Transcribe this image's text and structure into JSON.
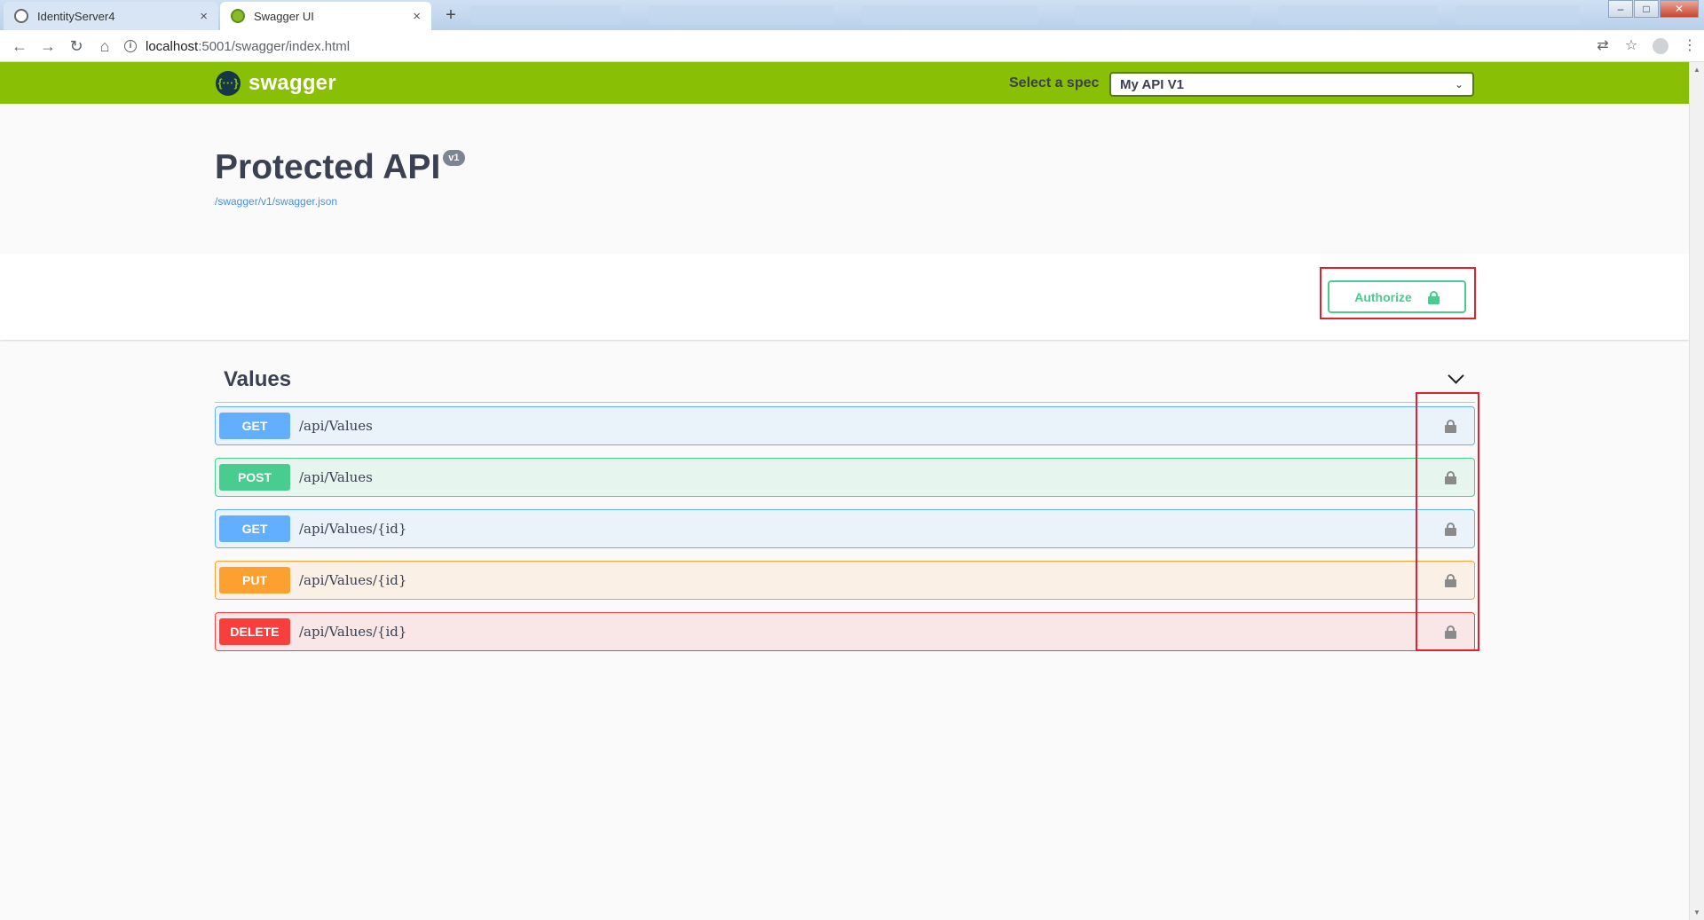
{
  "browser": {
    "tabs": [
      {
        "title": "IdentityServer4",
        "close": "×"
      },
      {
        "title": "Swagger UI",
        "close": "×"
      }
    ],
    "new_tab": "+",
    "url_host": "localhost",
    "url_path": ":5001/swagger/index.html",
    "nav": {
      "back": "←",
      "forward": "→",
      "reload": "↻",
      "home": "⌂"
    },
    "window_controls": {
      "minimize": "–",
      "maximize": "□",
      "close": "✕"
    },
    "toolbar_icons": {
      "translate": "⇄",
      "bookmark": "☆",
      "menu": "⋮"
    },
    "info_glyph": "i"
  },
  "swagger": {
    "logo_mark": "{···}",
    "logo_text": "swagger",
    "spec_label": "Select a spec",
    "spec_selected": "My API V1",
    "spec_chevron": "⌄"
  },
  "info": {
    "title": "Protected API",
    "version": "v1",
    "spec_url": "/swagger/v1/swagger.json"
  },
  "auth": {
    "authorize_label": "Authorize"
  },
  "tag": {
    "name": "Values"
  },
  "operations": [
    {
      "method": "GET",
      "path": "/api/Values"
    },
    {
      "method": "POST",
      "path": "/api/Values"
    },
    {
      "method": "GET",
      "path": "/api/Values/{id}"
    },
    {
      "method": "PUT",
      "path": "/api/Values/{id}"
    },
    {
      "method": "DELETE",
      "path": "/api/Values/{id}"
    }
  ],
  "colors": {
    "topbar": "#89bf04",
    "get": "#61affe",
    "post": "#49cc90",
    "put": "#fca130",
    "delete": "#f93e3e",
    "highlight": "#e0212f"
  }
}
